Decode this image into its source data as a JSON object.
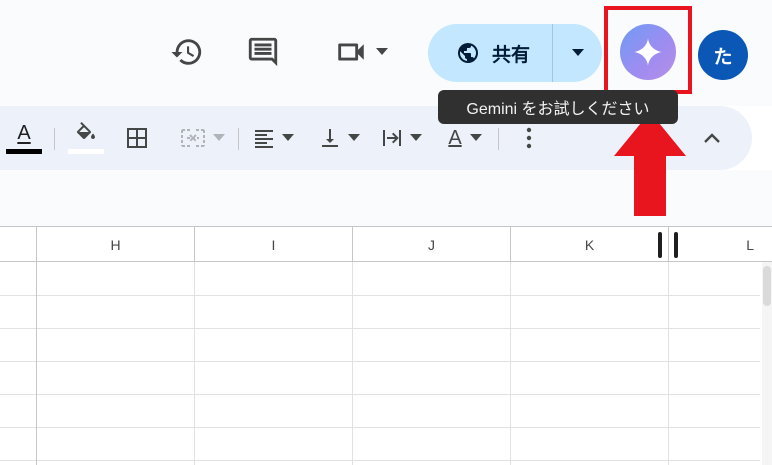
{
  "header": {
    "share_label": "共有",
    "avatar_initial": "た",
    "gemini_tooltip": "Gemini をお試しください"
  },
  "toolbar": {
    "text_color_glyph": "A",
    "rotate_glyph": "A"
  },
  "grid": {
    "columns": [
      "H",
      "I",
      "J",
      "K",
      "L"
    ]
  },
  "icons": {
    "history": "history-icon",
    "comment": "comment-icon",
    "meet": "video-camera-icon",
    "share": "globe-icon",
    "gemini": "sparkle-icon",
    "annotation": "arrow-up-icon"
  },
  "colors": {
    "share_bg": "#c2e7ff",
    "avatar_bg": "#0b57b5",
    "highlight_red": "#e8141e",
    "toolbar_bg": "#edf2fa"
  }
}
